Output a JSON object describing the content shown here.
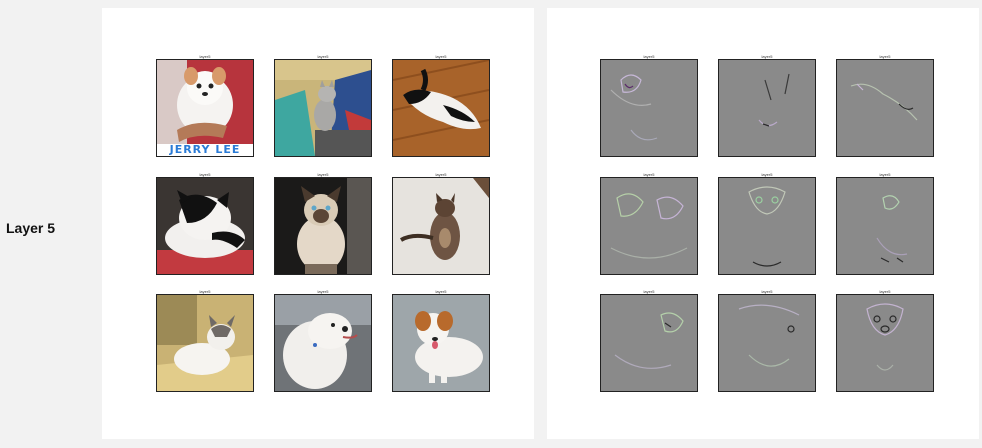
{
  "row_label": "Layer 5",
  "left_panel": {
    "items": [
      {
        "caption": "layer5",
        "subject": "white-dog-held",
        "banner": "JERRY LEE"
      },
      {
        "caption": "layer5",
        "subject": "grey-kitten"
      },
      {
        "caption": "layer5",
        "subject": "black-white-cat-on-floor"
      },
      {
        "caption": "layer5",
        "subject": "black-white-cat-on-red"
      },
      {
        "caption": "layer5",
        "subject": "siamese-cat"
      },
      {
        "caption": "layer5",
        "subject": "tortoiseshell-cat"
      },
      {
        "caption": "layer5",
        "subject": "white-grey-kitten"
      },
      {
        "caption": "layer5",
        "subject": "white-fluffy-dog"
      },
      {
        "caption": "layer5",
        "subject": "jack-russell-dog"
      }
    ]
  },
  "right_panel": {
    "items": [
      {
        "caption": "layer5"
      },
      {
        "caption": "layer5"
      },
      {
        "caption": "layer5"
      },
      {
        "caption": "layer5"
      },
      {
        "caption": "layer5"
      },
      {
        "caption": "layer5"
      },
      {
        "caption": "layer5"
      },
      {
        "caption": "layer5"
      },
      {
        "caption": "layer5"
      }
    ]
  },
  "colors": {
    "page_background": "#f2f2f2",
    "panel_background": "#ffffff",
    "saliency_gray": "#8a8a8a"
  }
}
